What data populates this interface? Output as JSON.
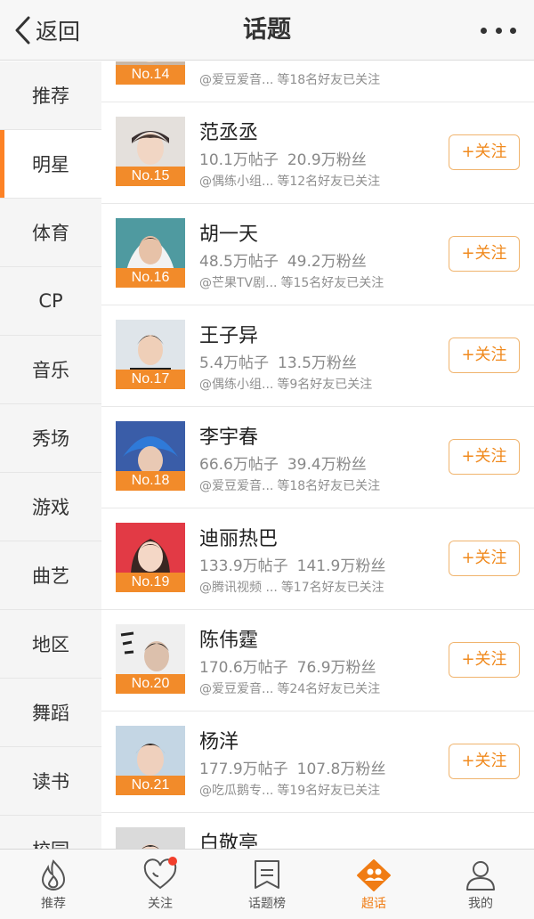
{
  "header": {
    "back_label": "返回",
    "title": "话题"
  },
  "sidebar": {
    "items": [
      {
        "label": "推荐",
        "active": false
      },
      {
        "label": "明星",
        "active": true
      },
      {
        "label": "体育",
        "active": false
      },
      {
        "label": "CP",
        "active": false
      },
      {
        "label": "音乐",
        "active": false
      },
      {
        "label": "秀场",
        "active": false
      },
      {
        "label": "游戏",
        "active": false
      },
      {
        "label": "曲艺",
        "active": false
      },
      {
        "label": "地区",
        "active": false
      },
      {
        "label": "舞蹈",
        "active": false
      },
      {
        "label": "读书",
        "active": false
      },
      {
        "label": "校园",
        "active": false
      }
    ]
  },
  "follow_label": "+关注",
  "rows": [
    {
      "rank": "No.14",
      "name": "",
      "posts": "",
      "fans": "",
      "source": "@爱豆爱音...",
      "friends": "等18名好友已关注",
      "thumb": "#c9b7a6"
    },
    {
      "rank": "No.15",
      "name": "范丞丞",
      "posts": "10.1万帖子",
      "fans": "20.9万粉丝",
      "source": "@偶练小组...",
      "friends": "等12名好友已关注",
      "thumb": "#d8d4d0"
    },
    {
      "rank": "No.16",
      "name": "胡一天",
      "posts": "48.5万帖子",
      "fans": "49.2万粉丝",
      "source": "@芒果TV剧...",
      "friends": "等15名好友已关注",
      "thumb": "#4f9aa0"
    },
    {
      "rank": "No.17",
      "name": "王子异",
      "posts": "5.4万帖子",
      "fans": "13.5万粉丝",
      "source": "@偶练小组...",
      "friends": "等9名好友已关注",
      "thumb": "#d6dde3"
    },
    {
      "rank": "No.18",
      "name": "李宇春",
      "posts": "66.6万帖子",
      "fans": "39.4万粉丝",
      "source": "@爱豆爱音...",
      "friends": "等18名好友已关注",
      "thumb": "#2f6fd0"
    },
    {
      "rank": "No.19",
      "name": "迪丽热巴",
      "posts": "133.9万帖子",
      "fans": "141.9万粉丝",
      "source": "@腾讯视频 ...",
      "friends": "等17名好友已关注",
      "thumb": "#e23a45"
    },
    {
      "rank": "No.20",
      "name": "陈伟霆",
      "posts": "170.6万帖子",
      "fans": "76.9万粉丝",
      "source": "@爱豆爱音...",
      "friends": "等24名好友已关注",
      "thumb": "#ececec"
    },
    {
      "rank": "No.21",
      "name": "杨洋",
      "posts": "177.9万帖子",
      "fans": "107.8万粉丝",
      "source": "@吃瓜鹅专...",
      "friends": "等19名好友已关注",
      "thumb": "#c4d6e4"
    },
    {
      "rank": "",
      "name": "白敬亭",
      "posts": "",
      "fans": "",
      "source": "",
      "friends": "",
      "thumb": "#dadada"
    }
  ],
  "tabbar": {
    "items": [
      {
        "label": "推荐",
        "icon": "flame-icon"
      },
      {
        "label": "关注",
        "icon": "heart-icon"
      },
      {
        "label": "话题榜",
        "icon": "list-icon"
      },
      {
        "label": "超话",
        "icon": "super-topic-icon"
      },
      {
        "label": "我的",
        "icon": "profile-icon"
      }
    ],
    "active": "超话"
  },
  "colors": {
    "accent": "#f07c14",
    "rank_bg": "#f28b2a",
    "follow_border": "#f0b46e",
    "badge": "#f23f2c"
  }
}
